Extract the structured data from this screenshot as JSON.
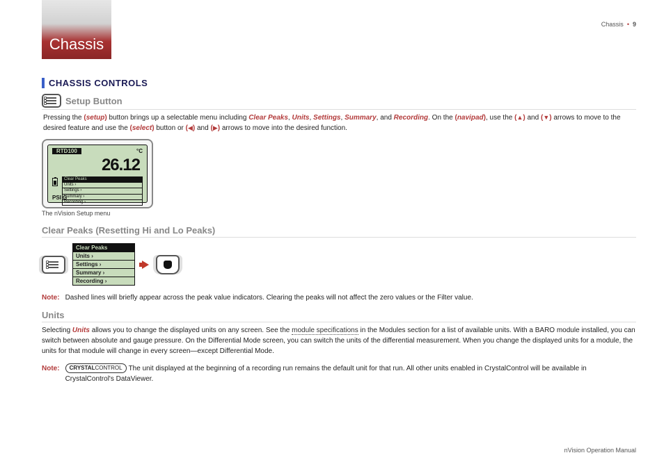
{
  "header": {
    "tab_title": "Chassis",
    "page_ref": "Chassis",
    "page_num": "9"
  },
  "section_title": "CHASSIS CONTROLS",
  "setup": {
    "heading": "Setup Button",
    "para_a1": "Pressing the ",
    "kw_setup": "setup",
    "para_a2": " button brings up a selectable menu including ",
    "kw_clear_peaks": "Clear Peaks",
    "kw_units": "Units",
    "kw_settings": "Settings",
    "kw_summary": "Summary",
    "kw_recording": "Recording",
    "para_a3": ". On the ",
    "kw_navipad": "navipad",
    "para_a4": ", use the ",
    "para_b1": " and ",
    "para_b2": " arrows to move to the desired feature and use the ",
    "kw_select": "select",
    "para_b3": " button or ",
    "para_b4": " and ",
    "para_b5": " arrows to move into the desired function."
  },
  "lcd": {
    "top_label": "RTD100",
    "top_unit": "°C",
    "value": "26.12",
    "menu": [
      "Clear Peaks",
      "Units ›",
      "Settings ›",
      "Summary ›",
      "Recording ›"
    ],
    "psi": "PSI G",
    "caption": "The nVision Setup menu"
  },
  "clear_peaks": {
    "heading": "Clear Peaks (Resetting Hi and Lo Peaks)",
    "menu": [
      "Clear Peaks",
      "Units ›",
      "Settings ›",
      "Summary ›",
      "Recording ›"
    ],
    "note_label": "Note:",
    "note_body": "Dashed lines will briefly appear across the peak value indicators. Clearing the peaks will not affect the zero values or the Filter value."
  },
  "units": {
    "heading": "Units",
    "p1a": "Selecting ",
    "kw_units": "Units",
    "p1b": " allows you to change the displayed units on any screen. See the ",
    "link": "module specifications",
    "p1c": " in the Modules section for a list of available units. With a BARO module installed, you can switch between absolute and gauge pressure.  On the Differential Mode screen, you can switch the units of the differential measurement. When you change the displayed units for a module, the units for that module will change in every screen—except Differential Mode.",
    "note_label": "Note:",
    "cc_logo_a": "CRYSTAL",
    "cc_logo_b": "CONTROL",
    "note_body": "The unit displayed at the beginning of a recording run remains the default unit for that run. All other units enabled in CrystalControl will be available in CrystalControl's DataViewer."
  },
  "footer": "nVision Operation Manual",
  "sep": ", ",
  "sep_and": ", and "
}
